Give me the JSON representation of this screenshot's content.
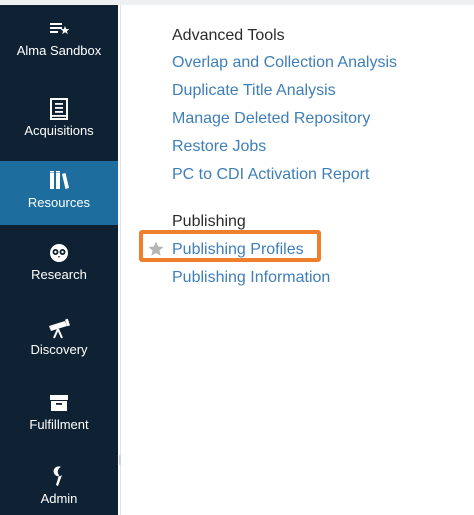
{
  "sidebar": {
    "items": [
      {
        "id": "alma-sandbox",
        "label": "Alma Sandbox",
        "icon": "menu-star-icon"
      },
      {
        "id": "acquisitions",
        "label": "Acquisitions",
        "icon": "ledger-icon"
      },
      {
        "id": "resources",
        "label": "Resources",
        "icon": "books-icon",
        "active": true
      },
      {
        "id": "research",
        "label": "Research",
        "icon": "owl-icon"
      },
      {
        "id": "discovery",
        "label": "Discovery",
        "icon": "telescope-icon"
      },
      {
        "id": "fulfillment",
        "label": "Fulfillment",
        "icon": "box-icon"
      },
      {
        "id": "admin",
        "label": "Admin",
        "icon": "wrench-icon"
      }
    ]
  },
  "menu": {
    "sections": [
      {
        "heading": "Advanced Tools",
        "links": [
          "Overlap and Collection Analysis",
          "Duplicate Title Analysis",
          "Manage Deleted Repository",
          "Restore Jobs",
          "PC to CDI Activation Report"
        ]
      },
      {
        "heading": "Publishing",
        "links": [
          "Publishing Profiles",
          "Publishing Information"
        ]
      }
    ]
  },
  "highlight": {
    "target": "Publishing Profiles",
    "color": "#ef7f2a"
  },
  "colors": {
    "sidebar_bg": "#0f2233",
    "active_bg": "#1d6e9e",
    "link": "#3f7fb8",
    "heading": "#2b2b2b",
    "star": "#b5b5b5"
  }
}
